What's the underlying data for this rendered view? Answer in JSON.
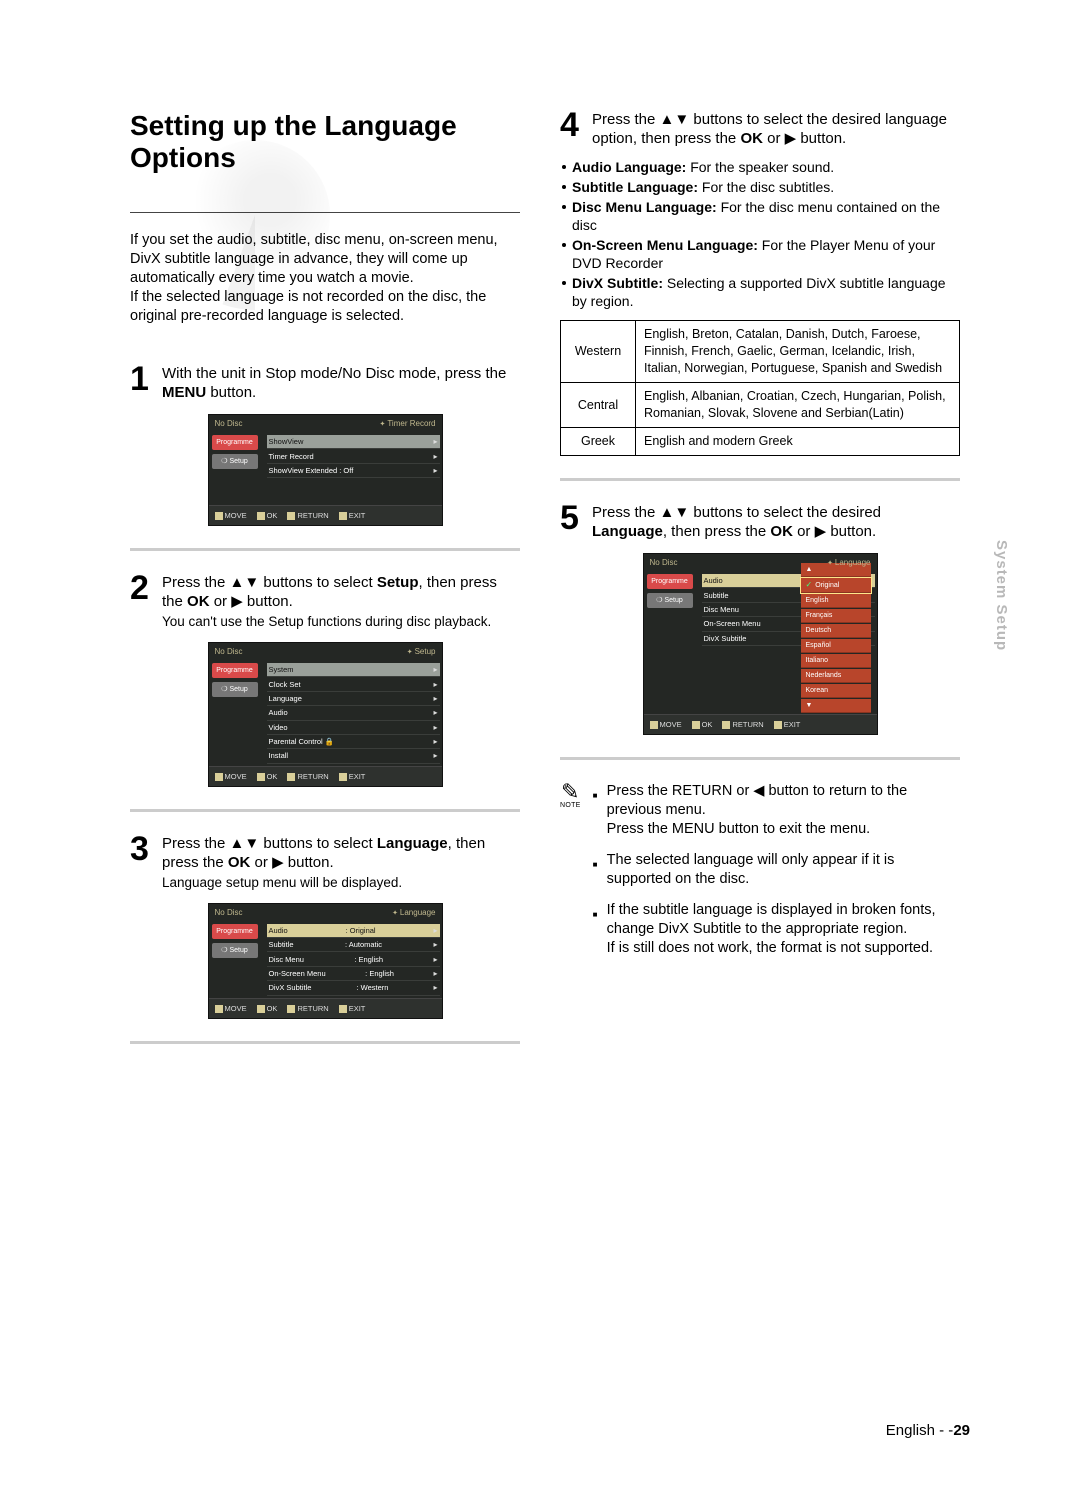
{
  "title": "Setting up the Language Options",
  "intro": [
    "If you set the audio, subtitle, disc menu, on-screen menu, DivX subtitle language in advance, they will come up automatically every time you watch a movie.",
    "If the selected language is not recorded on the disc, the original pre-recorded language is selected."
  ],
  "steps": {
    "s1": {
      "num": "1",
      "text_a": "With the unit in Stop mode/No Disc mode, press the ",
      "text_b": "MENU",
      "text_c": " button."
    },
    "s2": {
      "num": "2",
      "text_a": "Press the ",
      "arrows": "▲▼",
      "text_b": " buttons to select ",
      "bold": "Setup",
      "text_c": ", then press the ",
      "ok": "OK",
      "text_d": " or ",
      "play": "▶",
      "text_e": " button.",
      "sub": "You can't use the Setup functions during disc playback."
    },
    "s3": {
      "num": "3",
      "text_a": "Press the ",
      "arrows": "▲▼",
      "text_b": " buttons to select ",
      "bold": "Language",
      "text_c": ", then press the ",
      "ok": "OK",
      "text_d": " or ",
      "play": "▶",
      "text_e": " button.",
      "sub": "Language setup menu will be displayed."
    },
    "s4": {
      "num": "4",
      "text_a": "Press the ",
      "arrows": "▲▼",
      "text_b": " buttons to select the desired language option, then press the ",
      "ok": "OK",
      "text_c": " or ",
      "play": "▶",
      "text_d": " button."
    },
    "s5": {
      "num": "5",
      "text_a": "Press the ",
      "arrows": "▲▼",
      "text_b": " buttons to select the desired ",
      "bold": "Language",
      "text_c": ", then press the ",
      "ok": "OK",
      "text_d": " or ",
      "play": "▶",
      "text_e": " button."
    }
  },
  "step4_bullets": [
    {
      "bold": "Audio Language:",
      "txt": " For the speaker sound."
    },
    {
      "bold": "Subtitle Language:",
      "txt": " For the disc subtitles."
    },
    {
      "bold": "Disc Menu Language:",
      "txt": " For the disc menu contained on the disc"
    },
    {
      "bold": "On-Screen Menu Language:",
      "txt": " For the Player Menu of your DVD Recorder"
    },
    {
      "bold": "DivX Subtitle:",
      "txt": " Selecting a supported DivX subtitle language by region."
    }
  ],
  "lang_table": [
    {
      "region": "Western",
      "langs": "English, Breton, Catalan, Danish, Dutch, Faroese, Finnish, French, Gaelic, German, Icelandic, Irish, Italian, Norwegian, Portuguese, Spanish and Swedish"
    },
    {
      "region": "Central",
      "langs": "English, Albanian, Croatian, Czech, Hungarian, Polish, Romanian, Slovak, Slovene and Serbian(Latin)"
    },
    {
      "region": "Greek",
      "langs": "English and modern Greek"
    }
  ],
  "notes": [
    "Press the RETURN or ◀ button to return to the previous menu.\nPress the MENU button to exit the menu.",
    "The selected language will only appear if it is supported on the disc.",
    "If the subtitle language is displayed in broken fonts, change DivX Subtitle to the appropriate region.\nIf is still does not work, the format is not supported."
  ],
  "note_label": "NOTE",
  "osd1": {
    "title_l": "No Disc",
    "title_r": "Timer Record",
    "side": [
      "Programme",
      "Setup"
    ],
    "rows": [
      {
        "l": "ShowView",
        "r": "▸"
      },
      {
        "l": "Timer Record",
        "r": "▸"
      },
      {
        "l": "ShowView Extended : Off",
        "r": "▸"
      }
    ],
    "bot": [
      "MOVE",
      "OK",
      "RETURN",
      "EXIT"
    ]
  },
  "osd2": {
    "title_l": "No Disc",
    "title_r": "Setup",
    "side": [
      "Programme",
      "Setup"
    ],
    "rows": [
      {
        "l": "System",
        "r": "▸",
        "hi": true
      },
      {
        "l": "Clock Set",
        "r": "▸"
      },
      {
        "l": "Language",
        "r": "▸"
      },
      {
        "l": "Audio",
        "r": "▸"
      },
      {
        "l": "Video",
        "r": "▸"
      },
      {
        "l": "Parental Control 🔒",
        "r": "▸"
      },
      {
        "l": "Install",
        "r": "▸"
      }
    ],
    "bot": [
      "MOVE",
      "OK",
      "RETURN",
      "EXIT"
    ]
  },
  "osd3": {
    "title_l": "No Disc",
    "title_r": "Language",
    "side": [
      "Programme",
      "Setup"
    ],
    "rows": [
      {
        "l": "Audio",
        "v": ": Original",
        "r": "▸",
        "hi": true
      },
      {
        "l": "Subtitle",
        "v": ": Automatic",
        "r": "▸"
      },
      {
        "l": "Disc Menu",
        "v": ": English",
        "r": "▸"
      },
      {
        "l": "On-Screen Menu",
        "v": ": English",
        "r": "▸"
      },
      {
        "l": "DivX Subtitle",
        "v": ": Western",
        "r": "▸"
      }
    ],
    "bot": [
      "MOVE",
      "OK",
      "RETURN",
      "EXIT"
    ]
  },
  "osd5": {
    "title_l": "No Disc",
    "title_r": "Language",
    "side": [
      "Programme",
      "Setup"
    ],
    "rows": [
      {
        "l": "Audio",
        "r": ""
      },
      {
        "l": "Subtitle",
        "r": ""
      },
      {
        "l": "Disc Menu",
        "r": ""
      },
      {
        "l": "On-Screen Menu",
        "r": ""
      },
      {
        "l": "DivX Subtitle",
        "r": ""
      }
    ],
    "opts": [
      "Original",
      "English",
      "Français",
      "Deutsch",
      "Español",
      "Italiano",
      "Nederlands",
      "Korean"
    ],
    "bot": [
      "MOVE",
      "OK",
      "RETURN",
      "EXIT"
    ]
  },
  "sidelabel": "System Setup",
  "footer_lang": "English",
  "footer_page": "29"
}
